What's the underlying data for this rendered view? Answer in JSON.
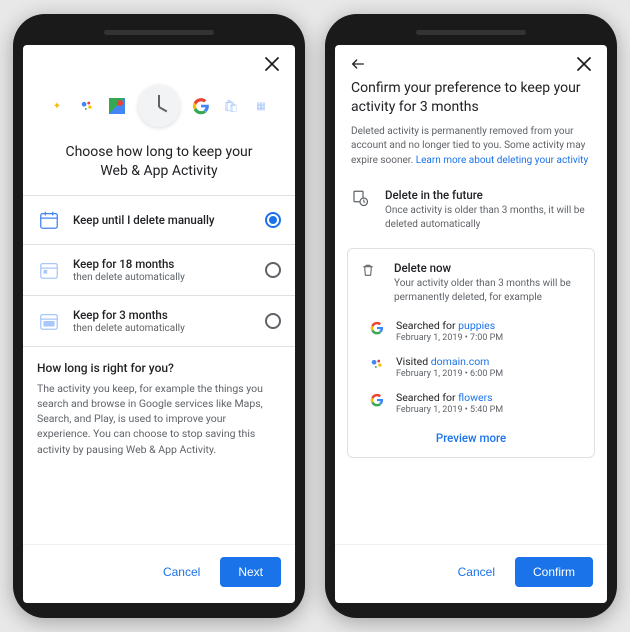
{
  "colors": {
    "accent": "#1a73e8",
    "text_secondary": "#5f6368"
  },
  "screen1": {
    "title": "Choose how long to keep your Web & App Activity",
    "options": [
      {
        "label": "Keep until I delete manually",
        "sub": "",
        "selected": true
      },
      {
        "label": "Keep for 18 months",
        "sub": "then delete automatically",
        "selected": false
      },
      {
        "label": "Keep for 3 months",
        "sub": "then delete automatically",
        "selected": false
      }
    ],
    "info_title": "How long is right for you?",
    "info_body": "The activity you keep, for example the things you search and browse in Google services like Maps, Search, and Play, is used to improve your experience. You can choose to stop saving this activity by pausing Web & App Activity.",
    "cancel": "Cancel",
    "next": "Next"
  },
  "screen2": {
    "title": "Confirm your preference to keep your activity for 3 months",
    "subtitle_pre": "Deleted activity is permanently removed from your account and no longer tied to you. Some activity may expire sooner. ",
    "subtitle_link": "Learn more about deleting your activity",
    "future_title": "Delete in the future",
    "future_desc": "Once activity is older than 3 months, it will be deleted automatically",
    "now_title": "Delete now",
    "now_desc": "Your activity older than 3 months will be permanently deleted, for example",
    "examples": [
      {
        "icon": "google",
        "prefix": "Searched for ",
        "term": "puppies",
        "time": "February 1, 2019 • 7:00 PM"
      },
      {
        "icon": "assistant",
        "prefix": "Visited ",
        "term": "domain.com",
        "time": "February 1, 2019 • 6:00 PM"
      },
      {
        "icon": "google",
        "prefix": "Searched for ",
        "term": "flowers",
        "time": "February 1, 2019 • 5:40 PM"
      }
    ],
    "preview_more": "Preview more",
    "cancel": "Cancel",
    "confirm": "Confirm"
  }
}
